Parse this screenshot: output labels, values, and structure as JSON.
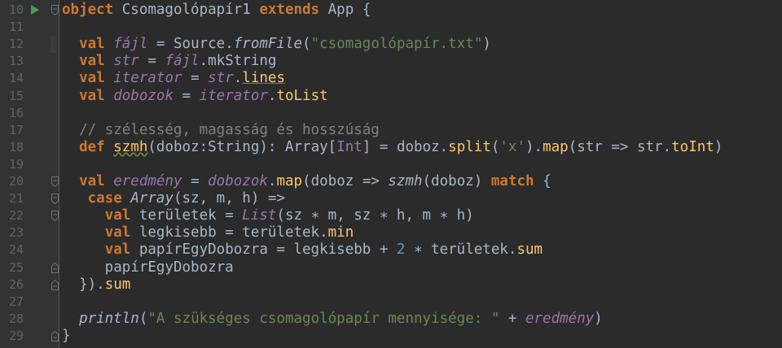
{
  "editor": {
    "lines": [
      {
        "n": "10",
        "tokens": [
          [
            "object",
            "kw"
          ],
          [
            " Csomagolópapír1 ",
            ""
          ],
          [
            "extends",
            "kw"
          ],
          [
            " App {",
            ""
          ]
        ]
      },
      {
        "n": "11",
        "tokens": []
      },
      {
        "n": "12",
        "tokens": [
          [
            "  ",
            ""
          ],
          [
            "val",
            "kw"
          ],
          [
            " ",
            ""
          ],
          [
            "fájl",
            "vi"
          ],
          [
            " = Source.",
            ""
          ],
          [
            "fromFile",
            "mi"
          ],
          [
            "(",
            ""
          ],
          [
            "\"csomagolópapír.txt\"",
            "str"
          ],
          [
            ")",
            ""
          ]
        ]
      },
      {
        "n": "13",
        "tokens": [
          [
            "  ",
            ""
          ],
          [
            "val",
            "kw"
          ],
          [
            " ",
            ""
          ],
          [
            "str",
            "vi"
          ],
          [
            " = ",
            ""
          ],
          [
            "fájl",
            "vi"
          ],
          [
            ".mkString",
            ""
          ]
        ]
      },
      {
        "n": "14",
        "tokens": [
          [
            "  ",
            ""
          ],
          [
            "val",
            "kw"
          ],
          [
            " ",
            ""
          ],
          [
            "iterator",
            "vi"
          ],
          [
            " = ",
            ""
          ],
          [
            "str",
            "vi"
          ],
          [
            ".",
            ""
          ],
          [
            "lines",
            "fn und"
          ]
        ]
      },
      {
        "n": "15",
        "tokens": [
          [
            "  ",
            ""
          ],
          [
            "val",
            "kw"
          ],
          [
            " ",
            ""
          ],
          [
            "dobozok",
            "vi"
          ],
          [
            " = ",
            ""
          ],
          [
            "iterator",
            "vi"
          ],
          [
            ".",
            ""
          ],
          [
            "toList",
            "fn"
          ]
        ]
      },
      {
        "n": "16",
        "tokens": []
      },
      {
        "n": "17",
        "tokens": [
          [
            "  ",
            ""
          ],
          [
            "// szélesség, magasság és hosszúság",
            "cm"
          ]
        ]
      },
      {
        "n": "18",
        "tokens": [
          [
            "  ",
            ""
          ],
          [
            "def",
            "kw"
          ],
          [
            " ",
            ""
          ],
          [
            "szmh",
            "fn wavy"
          ],
          [
            "(doboz:String): Array[",
            ""
          ],
          [
            "Int",
            "typ"
          ],
          [
            "] = doboz.",
            ""
          ],
          [
            "split",
            "fn"
          ],
          [
            "(",
            ""
          ],
          [
            "'x'",
            "str"
          ],
          [
            ").",
            ""
          ],
          [
            "map",
            "fn"
          ],
          [
            "(str => str.",
            ""
          ],
          [
            "toInt",
            "fn"
          ],
          [
            ")",
            ""
          ]
        ]
      },
      {
        "n": "19",
        "tokens": []
      },
      {
        "n": "20",
        "tokens": [
          [
            "  ",
            ""
          ],
          [
            "val",
            "kw"
          ],
          [
            " ",
            ""
          ],
          [
            "eredmény",
            "vi"
          ],
          [
            " = ",
            ""
          ],
          [
            "dobozok",
            "vi"
          ],
          [
            ".",
            ""
          ],
          [
            "map",
            "fn"
          ],
          [
            "(doboz => ",
            ""
          ],
          [
            "szmh",
            "mi"
          ],
          [
            "(doboz) ",
            ""
          ],
          [
            "match",
            "kw"
          ],
          [
            " {",
            ""
          ]
        ]
      },
      {
        "n": "21",
        "tokens": [
          [
            "   ",
            ""
          ],
          [
            "case",
            "kw"
          ],
          [
            " ",
            ""
          ],
          [
            "Array",
            "mi"
          ],
          [
            "(sz, m, h) =>",
            ""
          ]
        ]
      },
      {
        "n": "22",
        "tokens": [
          [
            "     ",
            ""
          ],
          [
            "val",
            "kw"
          ],
          [
            " területek = ",
            ""
          ],
          [
            "List",
            "vi"
          ],
          [
            "(sz ∗ m, sz ∗ h, m ∗ h)",
            ""
          ]
        ]
      },
      {
        "n": "23",
        "tokens": [
          [
            "     ",
            ""
          ],
          [
            "val",
            "kw"
          ],
          [
            " legkisebb = területek.",
            ""
          ],
          [
            "min",
            "fn"
          ]
        ]
      },
      {
        "n": "24",
        "tokens": [
          [
            "     ",
            ""
          ],
          [
            "val",
            "kw"
          ],
          [
            " papírEgyDobozra = legkisebb + ",
            ""
          ],
          [
            "2",
            "num"
          ],
          [
            " ∗ területek.",
            ""
          ],
          [
            "sum",
            "fn"
          ]
        ]
      },
      {
        "n": "25",
        "tokens": [
          [
            "     papírEgyDobozra",
            ""
          ]
        ]
      },
      {
        "n": "26",
        "tokens": [
          [
            "  }).",
            ""
          ],
          [
            "sum",
            "fn"
          ]
        ]
      },
      {
        "n": "27",
        "tokens": []
      },
      {
        "n": "28",
        "tokens": [
          [
            "  ",
            ""
          ],
          [
            "println",
            "mi"
          ],
          [
            "(",
            ""
          ],
          [
            "\"A szükséges csomagolópapír mennyisége: \"",
            "str"
          ],
          [
            " + ",
            ""
          ],
          [
            "eredmény",
            "vi"
          ],
          [
            ")",
            ""
          ]
        ]
      },
      {
        "n": "29",
        "tokens": [
          [
            "}",
            ""
          ]
        ]
      }
    ]
  }
}
